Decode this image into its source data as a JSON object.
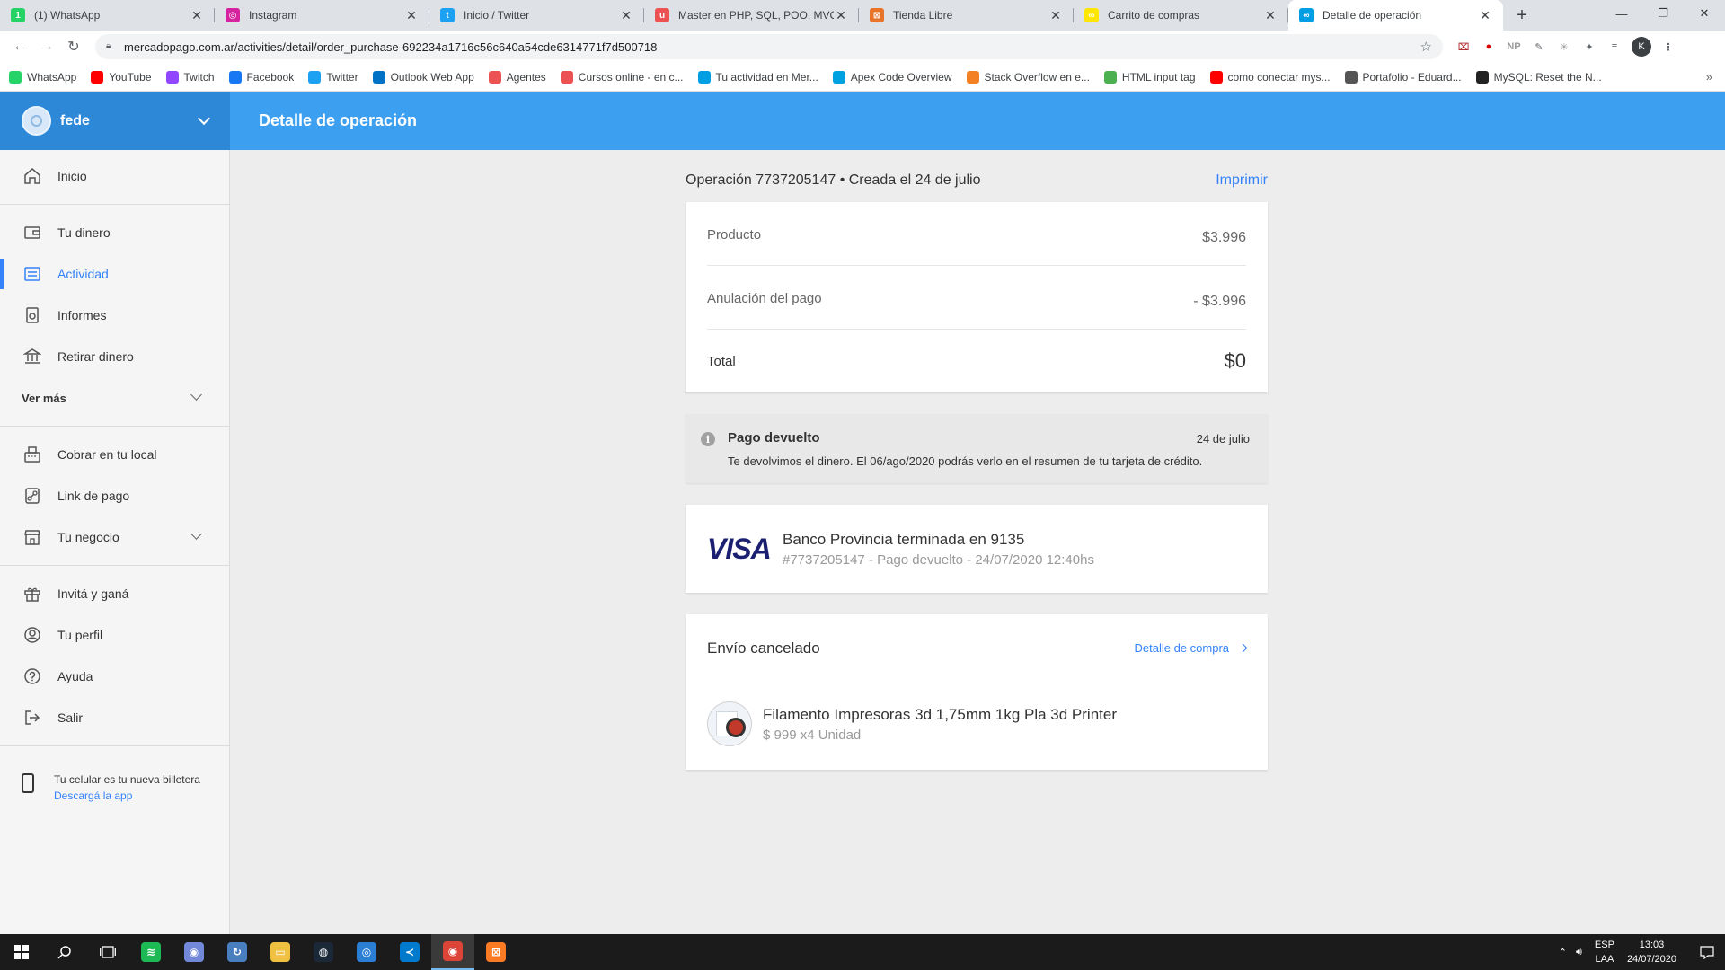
{
  "browser": {
    "tabs": [
      {
        "title": "(1) WhatsApp",
        "icon": "whatsapp-icon",
        "color": "#25d366",
        "glyph": "1"
      },
      {
        "title": "Instagram",
        "icon": "instagram-icon",
        "color": "#d6249f",
        "glyph": "◎"
      },
      {
        "title": "Inicio / Twitter",
        "icon": "twitter-icon",
        "color": "#1da1f2",
        "glyph": "t"
      },
      {
        "title": "Master en PHP, SQL, POO, MVC,",
        "icon": "udemy-icon",
        "color": "#ec5252",
        "glyph": "u"
      },
      {
        "title": "Tienda Libre",
        "icon": "store-icon",
        "color": "#e8742a",
        "glyph": "⊠"
      },
      {
        "title": "Carrito de compras",
        "icon": "mercadolibre-icon",
        "color": "#ffe600",
        "glyph": "∞"
      },
      {
        "title": "Detalle de operación",
        "icon": "mercadopago-icon",
        "color": "#009ee3",
        "glyph": "∞",
        "active": true
      }
    ],
    "url": "mercadopago.com.ar/activities/detail/order_purchase-692234a1716c56c640a54cde6314771f7d500718",
    "bookmarks": [
      {
        "label": "WhatsApp",
        "icon": "whatsapp-icon",
        "color": "#25d366"
      },
      {
        "label": "YouTube",
        "icon": "youtube-icon",
        "color": "#ff0000"
      },
      {
        "label": "Twitch",
        "icon": "twitch-icon",
        "color": "#9146ff"
      },
      {
        "label": "Facebook",
        "icon": "facebook-icon",
        "color": "#1877f2"
      },
      {
        "label": "Twitter",
        "icon": "twitter-icon",
        "color": "#1da1f2"
      },
      {
        "label": "Outlook Web App",
        "icon": "outlook-icon",
        "color": "#0072c6"
      },
      {
        "label": "Agentes",
        "icon": "udemy-icon",
        "color": "#ec5252"
      },
      {
        "label": "Cursos online - en c...",
        "icon": "udemy-icon",
        "color": "#ec5252"
      },
      {
        "label": "Tu actividad en Mer...",
        "icon": "mercadopago-icon",
        "color": "#009ee3"
      },
      {
        "label": "Apex Code Overview",
        "icon": "salesforce-icon",
        "color": "#00a1e0"
      },
      {
        "label": "Stack Overflow en e...",
        "icon": "stackoverflow-icon",
        "color": "#f48024"
      },
      {
        "label": "HTML input tag",
        "icon": "w3schools-icon",
        "color": "#4caf50"
      },
      {
        "label": "como conectar mys...",
        "icon": "youtube-icon",
        "color": "#ff0000"
      },
      {
        "label": "Portafolio - Eduard...",
        "icon": "person-icon",
        "color": "#555555"
      },
      {
        "label": "MySQL: Reset the N...",
        "icon": "tutorialspoint-icon",
        "color": "#222222"
      }
    ],
    "profile_initial": "K"
  },
  "header": {
    "user_name": "fede",
    "title": "Detalle de operación"
  },
  "sidebar": {
    "group1": [
      {
        "label": "Inicio",
        "icon": "home-icon"
      }
    ],
    "group2": [
      {
        "label": "Tu dinero",
        "icon": "wallet-icon"
      },
      {
        "label": "Actividad",
        "icon": "activity-list-icon",
        "active": true
      },
      {
        "label": "Informes",
        "icon": "reports-icon"
      },
      {
        "label": "Retirar dinero",
        "icon": "bank-icon"
      }
    ],
    "ver_mas": "Ver más",
    "group3": [
      {
        "label": "Cobrar en tu local",
        "icon": "pos-register-icon"
      },
      {
        "label": "Link de pago",
        "icon": "payment-link-icon"
      },
      {
        "label": "Tu negocio",
        "icon": "store-icon",
        "expandable": true
      }
    ],
    "group4": [
      {
        "label": "Invitá y ganá",
        "icon": "gift-icon"
      },
      {
        "label": "Tu perfil",
        "icon": "profile-icon"
      },
      {
        "label": "Ayuda",
        "icon": "help-icon"
      },
      {
        "label": "Salir",
        "icon": "logout-icon"
      }
    ],
    "promo": {
      "text": "Tu celular es tu nueva billetera",
      "link": "Descargá la app"
    }
  },
  "operation": {
    "header": "Operación 7737205147 • Creada el 24 de julio",
    "print_label": "Imprimir",
    "summary": [
      {
        "label": "Producto",
        "value": "$3.996"
      },
      {
        "label": "Anulación del pago",
        "value": "- $3.996"
      }
    ],
    "total_label": "Total",
    "total_value": "$0",
    "notice": {
      "title": "Pago devuelto",
      "date": "24 de julio",
      "body": "Te devolvimos el dinero. El 06/ago/2020 podrás verlo en el resumen de tu tarjeta de crédito."
    },
    "payment": {
      "brand": "VISA",
      "bank": "Banco Provincia terminada en 9135",
      "detail": "#7737205147 - Pago devuelto - 24/07/2020 12:40hs"
    },
    "shipping": {
      "status": "Envío cancelado",
      "detail_link": "Detalle de compra",
      "item_name": "Filamento Impresoras 3d 1,75mm 1kg Pla 3d Printer",
      "item_price": "$ 999 x4 Unidad"
    }
  },
  "taskbar": {
    "apps": [
      {
        "name": "spotify-icon",
        "color": "#1db954",
        "glyph": "≋"
      },
      {
        "name": "discord-icon",
        "color": "#7289da",
        "glyph": "◉"
      },
      {
        "name": "sync-icon",
        "color": "#4a7fbf",
        "glyph": "↻"
      },
      {
        "name": "file-explorer-icon",
        "color": "#f0c040",
        "glyph": "▭"
      },
      {
        "name": "steam-icon",
        "color": "#1b2838",
        "glyph": "◍"
      },
      {
        "name": "uplay-icon",
        "color": "#2a7fd4",
        "glyph": "◎"
      },
      {
        "name": "vscode-icon",
        "color": "#007acc",
        "glyph": "≺"
      },
      {
        "name": "chrome-icon",
        "color": "#db4437",
        "glyph": "◉",
        "active": true
      },
      {
        "name": "xampp-icon",
        "color": "#fb7a24",
        "glyph": "⊠"
      }
    ],
    "lang_top": "ESP",
    "lang_bottom": "LAA",
    "time": "13:03",
    "date": "24/07/2020"
  }
}
